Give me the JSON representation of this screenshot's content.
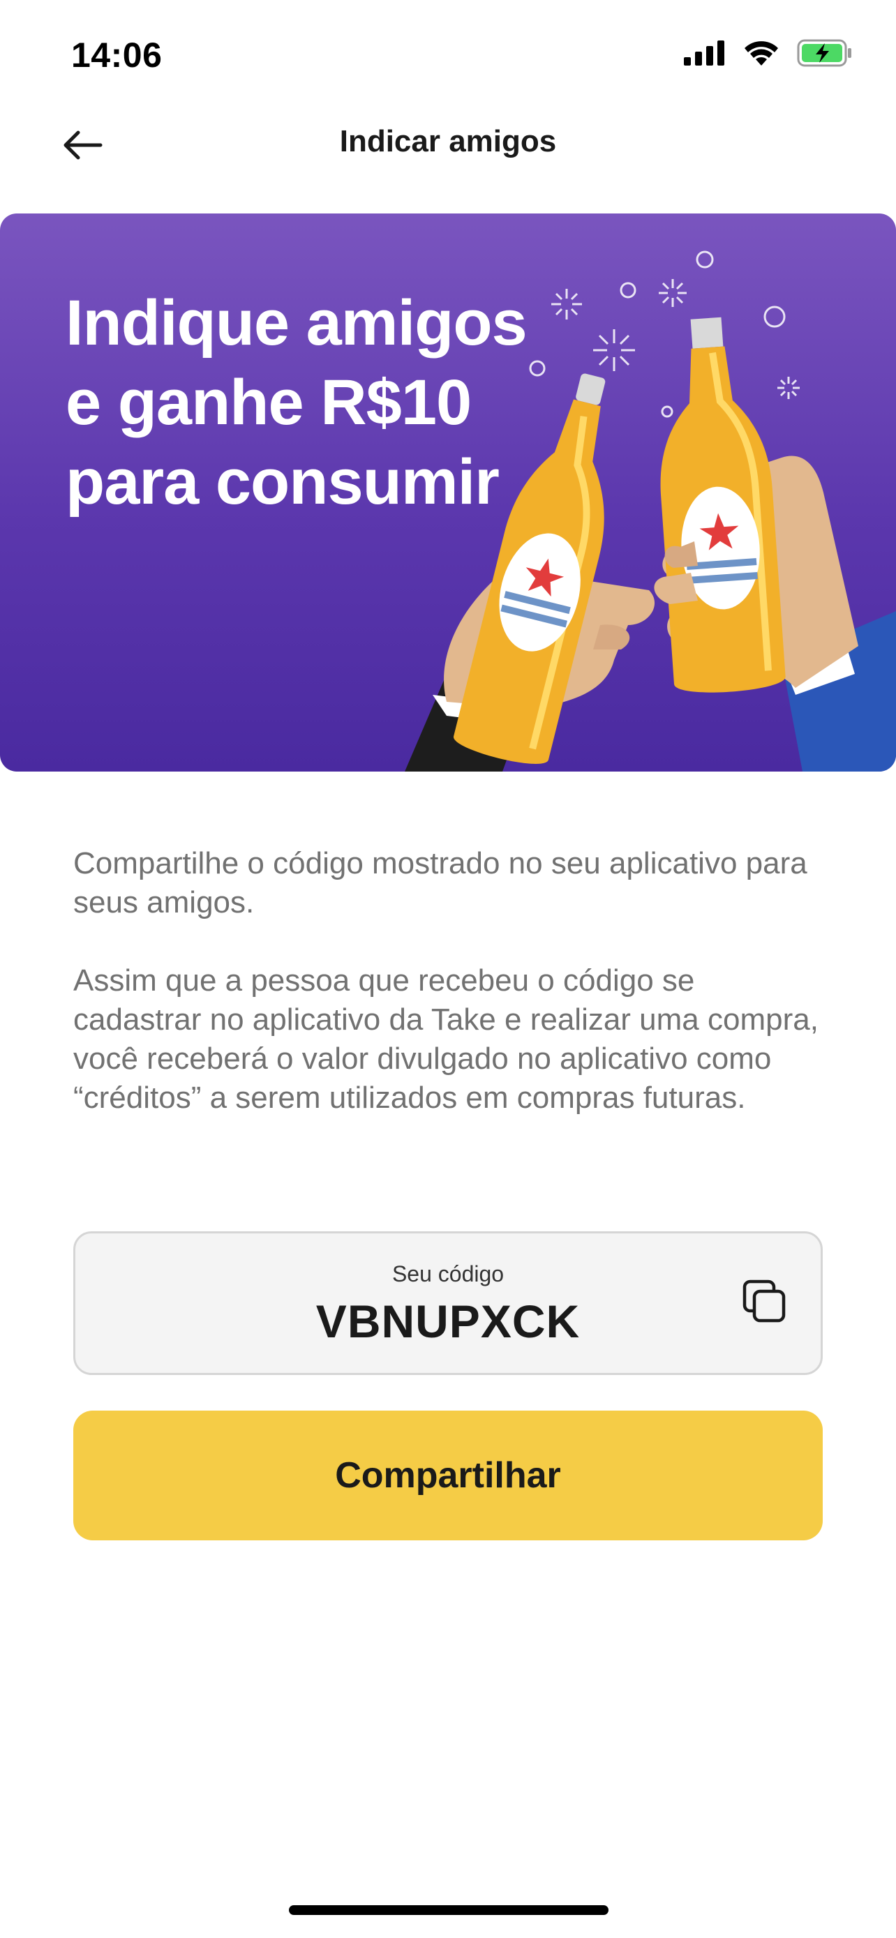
{
  "status_bar": {
    "time": "14:06",
    "icons": [
      "signal-icon",
      "wifi-icon",
      "battery-charging-icon"
    ],
    "battery_color": "#4cd964"
  },
  "header": {
    "title": "Indicar amigos",
    "back_icon": "arrow-left-icon"
  },
  "banner": {
    "headline_lines": [
      "Indique amigos",
      "e ganhe R$10",
      "para consumir"
    ],
    "gradient_colors": [
      "#7a55bf",
      "#4a2aa0"
    ]
  },
  "body": {
    "paragraph_1": "Compartilhe o código mostrado no seu aplicativo para seus amigos.",
    "paragraph_2": "Assim que a pessoa que recebeu o código se cadastrar no aplicativo da Take e realizar uma compra, você receberá o valor divulgado no aplicativo como “créditos” a serem utilizados em compras futuras."
  },
  "referral": {
    "label": "Seu código",
    "code": "VBNUPXCK",
    "copy_icon": "copy-icon"
  },
  "share_button": {
    "label": "Compartilhar",
    "color": "#f5cc46"
  }
}
